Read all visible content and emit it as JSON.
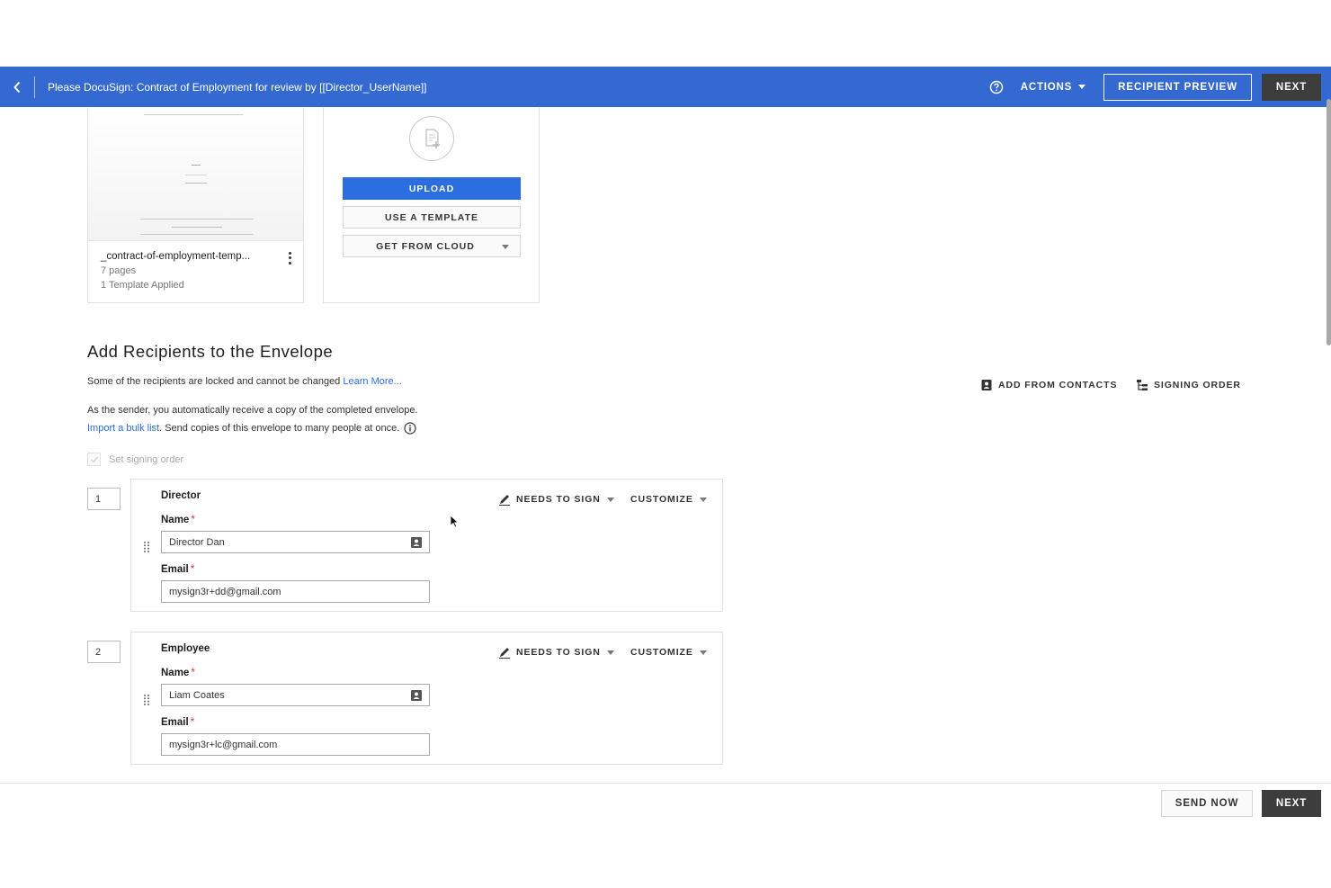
{
  "header": {
    "title": "Please DocuSign: Contract of Employment for review by [[Director_UserName]]",
    "actions_label": "ACTIONS",
    "recipient_preview_label": "RECIPIENT PREVIEW",
    "next_label": "NEXT",
    "background_color": "#3469d1"
  },
  "document": {
    "name": "_contract-of-employment-temp...",
    "pages": "7 pages",
    "templates": "1 Template Applied"
  },
  "upload": {
    "upload_label": "UPLOAD",
    "template_label": "USE A TEMPLATE",
    "cloud_label": "GET FROM CLOUD",
    "accent_color": "#2b6ee0"
  },
  "recipients": {
    "title": "Add Recipients to the Envelope",
    "locked_text": "Some of the recipients are locked and cannot be changed",
    "learn_more": "Learn More...",
    "copy_text": "As the sender, you automatically receive a copy of the completed envelope.",
    "bulk_link": "Import a bulk list",
    "bulk_text": ". Send copies of this envelope to many people at once.",
    "set_signing_order": "Set signing order",
    "add_from_contacts": "ADD FROM CONTACTS",
    "signing_order": "SIGNING ORDER",
    "list": [
      {
        "order": "1",
        "role": "Director",
        "action": "NEEDS TO SIGN",
        "customize": "CUSTOMIZE",
        "name_label": "Name",
        "name_value": "Director Dan",
        "email_label": "Email",
        "email_value": "mysign3r+dd@gmail.com"
      },
      {
        "order": "2",
        "role": "Employee",
        "action": "NEEDS TO SIGN",
        "customize": "CUSTOMIZE",
        "name_label": "Name",
        "name_value": "Liam Coates",
        "email_label": "Email",
        "email_value": "mysign3r+lc@gmail.com"
      }
    ],
    "required_mark": "*"
  },
  "footer": {
    "send_now_label": "SEND NOW",
    "next_label": "NEXT"
  }
}
